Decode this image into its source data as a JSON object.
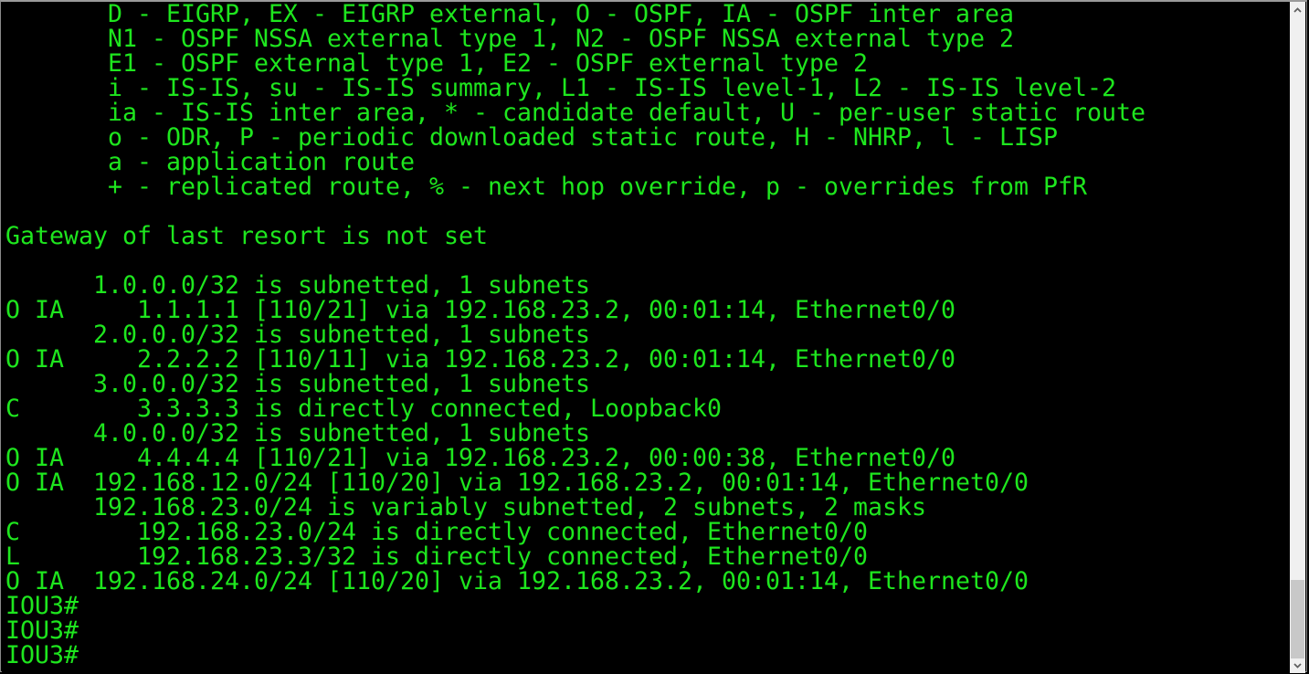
{
  "terminal": {
    "text_color": "#1ee61e",
    "background": "#000000",
    "lines": [
      "       D - EIGRP, EX - EIGRP external, O - OSPF, IA - OSPF inter area",
      "       N1 - OSPF NSSA external type 1, N2 - OSPF NSSA external type 2",
      "       E1 - OSPF external type 1, E2 - OSPF external type 2",
      "       i - IS-IS, su - IS-IS summary, L1 - IS-IS level-1, L2 - IS-IS level-2",
      "       ia - IS-IS inter area, * - candidate default, U - per-user static route",
      "       o - ODR, P - periodic downloaded static route, H - NHRP, l - LISP",
      "       a - application route",
      "       + - replicated route, % - next hop override, p - overrides from PfR",
      "",
      "Gateway of last resort is not set",
      "",
      "      1.0.0.0/32 is subnetted, 1 subnets",
      "O IA     1.1.1.1 [110/21] via 192.168.23.2, 00:01:14, Ethernet0/0",
      "      2.0.0.0/32 is subnetted, 1 subnets",
      "O IA     2.2.2.2 [110/11] via 192.168.23.2, 00:01:14, Ethernet0/0",
      "      3.0.0.0/32 is subnetted, 1 subnets",
      "C        3.3.3.3 is directly connected, Loopback0",
      "      4.0.0.0/32 is subnetted, 1 subnets",
      "O IA     4.4.4.4 [110/21] via 192.168.23.2, 00:00:38, Ethernet0/0",
      "O IA  192.168.12.0/24 [110/20] via 192.168.23.2, 00:01:14, Ethernet0/0",
      "      192.168.23.0/24 is variably subnetted, 2 subnets, 2 masks",
      "C        192.168.23.0/24 is directly connected, Ethernet0/0",
      "L        192.168.23.3/32 is directly connected, Ethernet0/0",
      "O IA  192.168.24.0/24 [110/20] via 192.168.23.2, 00:01:14, Ethernet0/0",
      "IOU3#",
      "IOU3#",
      "IOU3#"
    ]
  },
  "scrollbar": {
    "up_icon": "chevron-up-icon",
    "down_icon": "chevron-down-icon",
    "position_fraction": 1.0
  }
}
